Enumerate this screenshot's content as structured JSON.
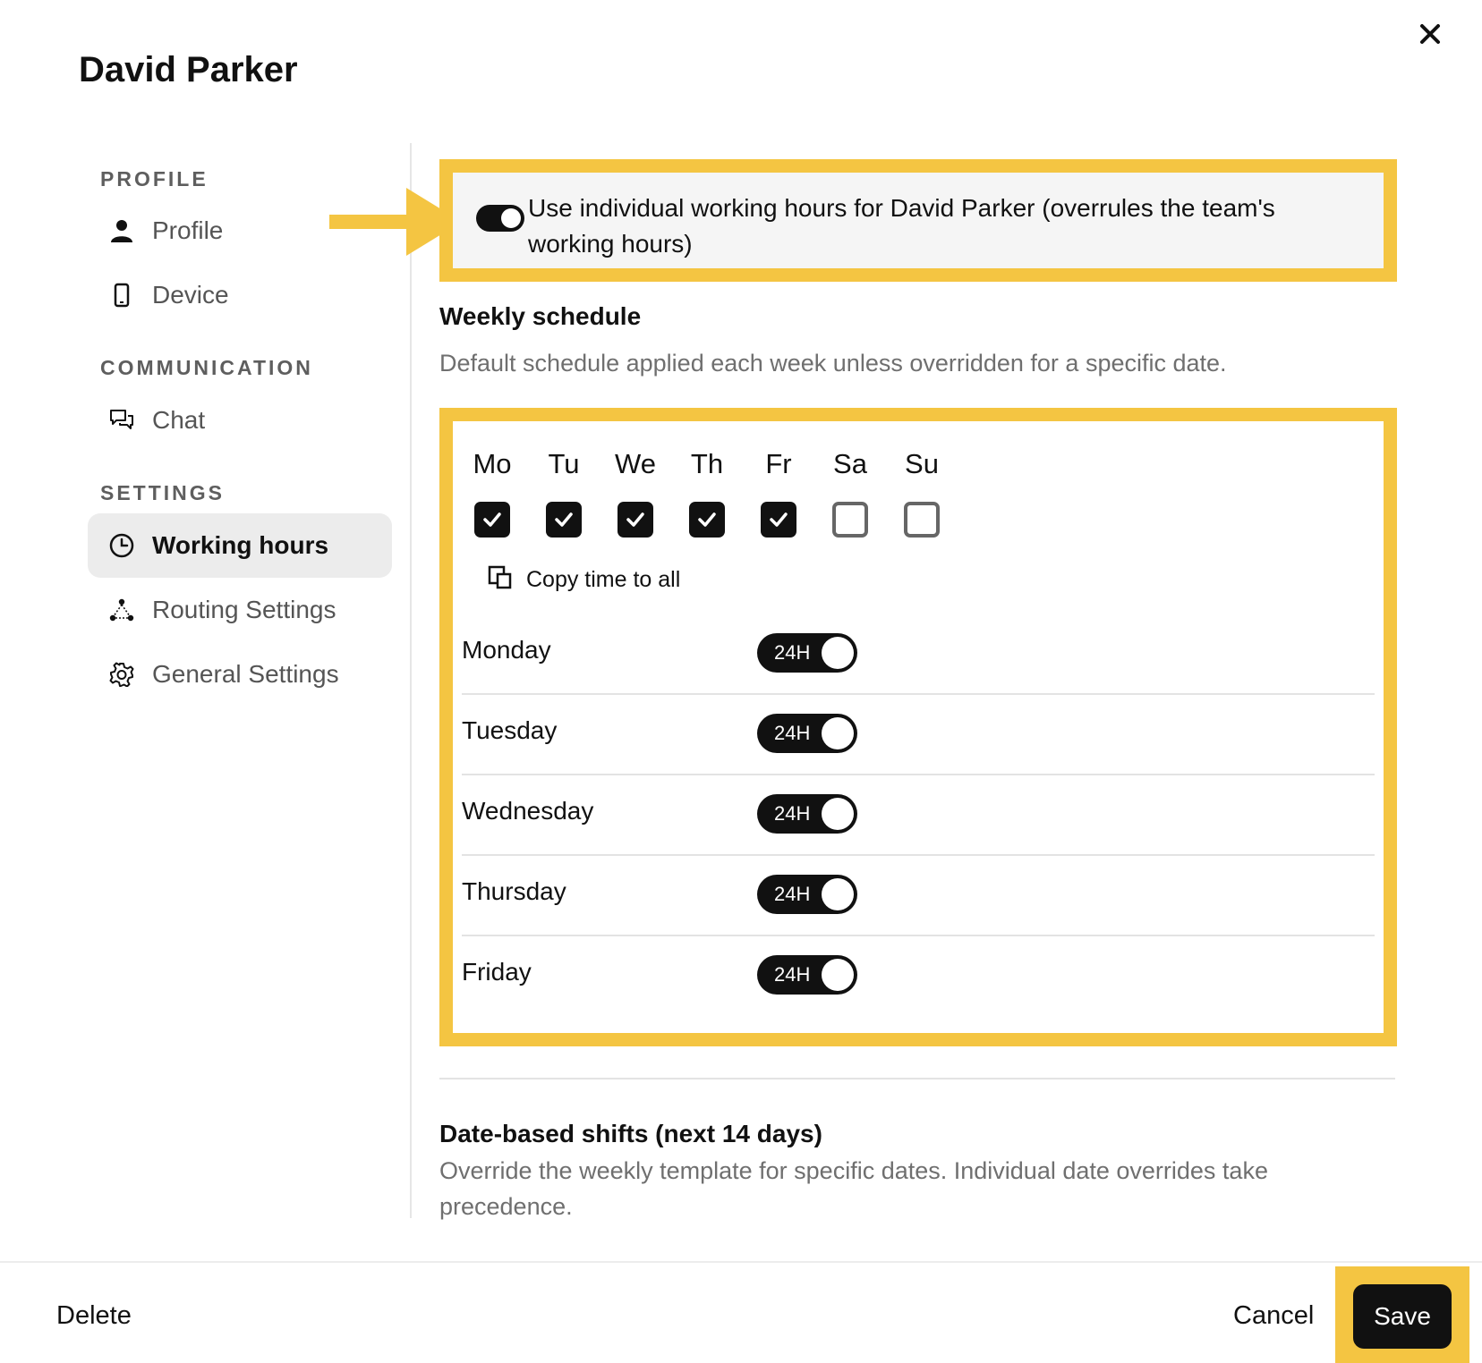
{
  "header": {
    "title": "David Parker"
  },
  "sidebar": {
    "sections": [
      {
        "label": "PROFILE",
        "items": [
          {
            "label": "Profile",
            "icon": "person-icon"
          },
          {
            "label": "Device",
            "icon": "phone-icon"
          }
        ]
      },
      {
        "label": "COMMUNICATION",
        "items": [
          {
            "label": "Chat",
            "icon": "chat-icon"
          }
        ]
      },
      {
        "label": "SETTINGS",
        "items": [
          {
            "label": "Working hours",
            "icon": "clock-icon",
            "active": true
          },
          {
            "label": "Routing Settings",
            "icon": "routing-icon"
          },
          {
            "label": "General Settings",
            "icon": "gear-icon"
          }
        ]
      }
    ]
  },
  "main": {
    "individual_toggle": {
      "label": "Use individual working hours for David Parker (overrules the team's working hours)",
      "on": true
    },
    "weekly": {
      "title": "Weekly schedule",
      "description": "Default schedule applied each week unless overridden for a specific date.",
      "days": [
        {
          "abbr": "Mo",
          "checked": true
        },
        {
          "abbr": "Tu",
          "checked": true
        },
        {
          "abbr": "We",
          "checked": true
        },
        {
          "abbr": "Th",
          "checked": true
        },
        {
          "abbr": "Fr",
          "checked": true
        },
        {
          "abbr": "Sa",
          "checked": false
        },
        {
          "abbr": "Su",
          "checked": false
        }
      ],
      "copy_label": "Copy time to all",
      "rows": [
        {
          "day": "Monday",
          "toggle": "24H",
          "on": true
        },
        {
          "day": "Tuesday",
          "toggle": "24H",
          "on": true
        },
        {
          "day": "Wednesday",
          "toggle": "24H",
          "on": true
        },
        {
          "day": "Thursday",
          "toggle": "24H",
          "on": true
        },
        {
          "day": "Friday",
          "toggle": "24H",
          "on": true
        }
      ]
    },
    "date_shifts": {
      "title": "Date-based shifts (next 14 days)",
      "description": "Override the weekly template for specific dates. Individual date overrides take precedence."
    }
  },
  "footer": {
    "delete_label": "Delete",
    "cancel_label": "Cancel",
    "save_label": "Save"
  },
  "colors": {
    "highlight": "#f4c542",
    "primary": "#111111",
    "muted": "#6f6f6f"
  }
}
